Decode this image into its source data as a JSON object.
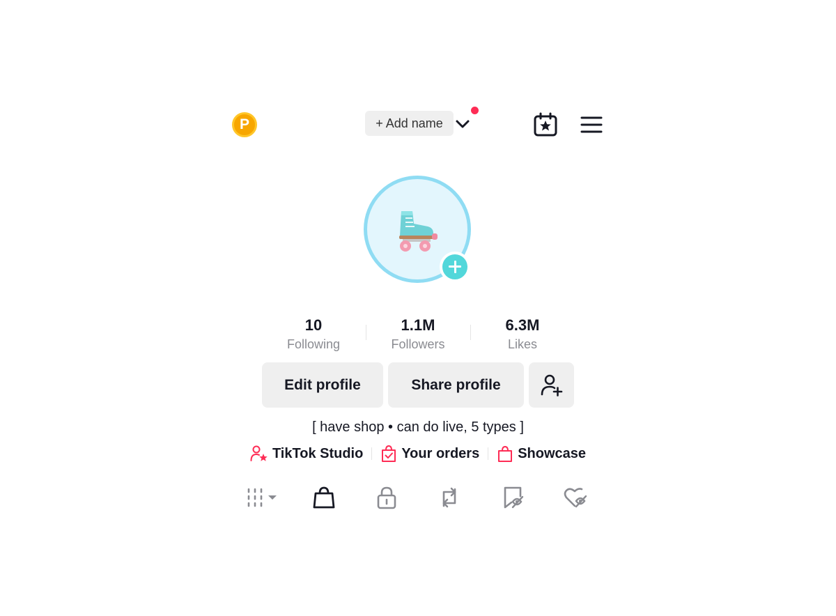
{
  "header": {
    "coin_letter": "P",
    "add_name_label": "+ Add name",
    "icons": {
      "coin": "points-coin-icon",
      "chevron": "chevron-down-icon",
      "calendar": "calendar-star-icon",
      "menu": "hamburger-menu-icon"
    },
    "notification_dot_color": "#fe2c55"
  },
  "avatar": {
    "emoji_icon": "roller-skate-icon",
    "ring_color": "#8fdcf3",
    "badge_color": "#52d7da"
  },
  "stats": [
    {
      "value": "10",
      "label": "Following"
    },
    {
      "value": "1.1M",
      "label": "Followers"
    },
    {
      "value": "6.3M",
      "label": "Likes"
    }
  ],
  "buttons": {
    "edit": "Edit profile",
    "share": "Share profile",
    "add_friend_icon": "add-friend-icon"
  },
  "bio": "[ have shop • can do live, 5 types ]",
  "links": [
    {
      "label": "TikTok Studio",
      "icon": "studio-person-star-icon"
    },
    {
      "label": "Your orders",
      "icon": "orders-bag-check-icon"
    },
    {
      "label": "Showcase",
      "icon": "showcase-bag-icon"
    }
  ],
  "tabs": [
    "videos-grid-icon",
    "shop-bag-icon",
    "private-lock-icon",
    "reposts-icon",
    "favorites-icon",
    "liked-icon"
  ],
  "colors": {
    "accent": "#fe2c55",
    "text": "#161823",
    "muted": "#8a8b91",
    "button_bg": "#efefef"
  }
}
